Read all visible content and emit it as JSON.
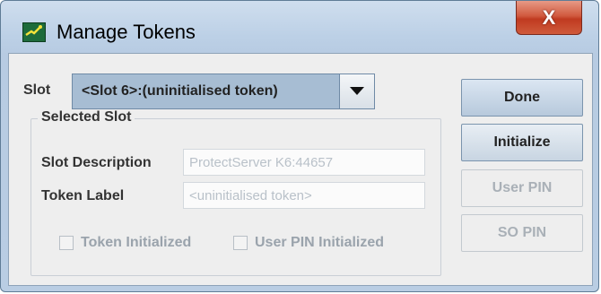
{
  "window": {
    "title": "Manage Tokens",
    "close_glyph": "X",
    "app_icon": "token-manager-icon"
  },
  "slot": {
    "label": "Slot",
    "selected": "<Slot 6>:(uninitialised token)"
  },
  "selected_slot": {
    "group_title": "Selected Slot",
    "description_label": "Slot Description",
    "description_value": "ProtectServer K6:44657",
    "token_label_label": "Token Label",
    "token_label_value": "<uninitialised token>",
    "token_initialized_label": "Token Initialized",
    "user_pin_initialized_label": "User PIN Initialized"
  },
  "buttons": {
    "done": "Done",
    "initialize": "Initialize",
    "user_pin": "User PIN",
    "so_pin": "SO PIN"
  },
  "colors": {
    "close_button": "#c94a2e",
    "combo_background": "#a7bdd3",
    "disabled_text": "#a9b0b7"
  }
}
